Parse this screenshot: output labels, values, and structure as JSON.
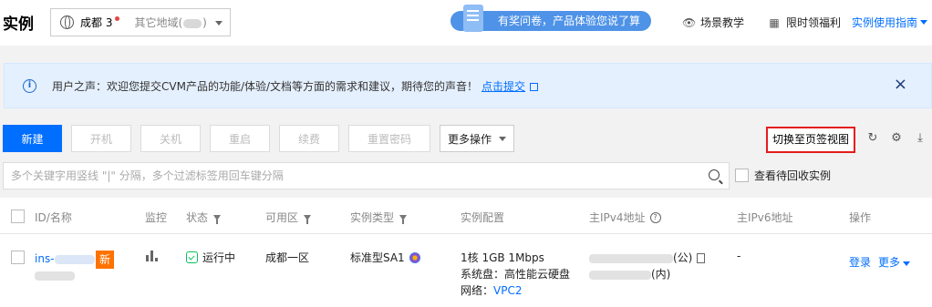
{
  "header": {
    "title": "实例",
    "region_current": "成都 3",
    "region_other": "其它地域(",
    "region_other_close": ")",
    "survey_text": "有奖问卷，产品体验您说了算",
    "scene_teach": "场景教学",
    "limited_welfare": "限时领福利",
    "guide": "实例使用指南"
  },
  "banner": {
    "message": "用户之声：欢迎您提交CVM产品的功能/体验/文档等方面的需求和建议，期待您的声音！",
    "link": "点击提交",
    "close": "×"
  },
  "toolbar": {
    "new": "新建",
    "power_on": "开机",
    "power_off": "关机",
    "restart": "重启",
    "renew": "续费",
    "reset_password": "重置密码",
    "more_actions": "更多操作",
    "switch_view": "切换至页签视图"
  },
  "search": {
    "placeholder": "多个关键字用竖线 \"|\" 分隔，多个过滤标签用回车键分隔",
    "recycle_label": "查看待回收实例"
  },
  "table": {
    "headers": {
      "id_name": "ID/名称",
      "monitor": "监控",
      "status": "状态",
      "zone": "可用区",
      "type": "实例类型",
      "config": "实例配置",
      "ipv4": "主IPv4地址",
      "ipv6": "主IPv6地址",
      "actions": "操作"
    },
    "rows": [
      {
        "id_prefix": "ins-",
        "new_badge": "新",
        "status": "运行中",
        "zone": "成都一区",
        "type": "标准型SA1",
        "config_line1": "1核 1GB 1Mbps",
        "config_line2": "系统盘：高性能云硬盘",
        "config_line3_label": "网络：",
        "config_line3_value": "VPC2",
        "ipv4_public_suffix": "(公)",
        "ipv4_private_suffix": "(内)",
        "ipv6": "-",
        "login": "登录",
        "more": "更多"
      }
    ]
  }
}
